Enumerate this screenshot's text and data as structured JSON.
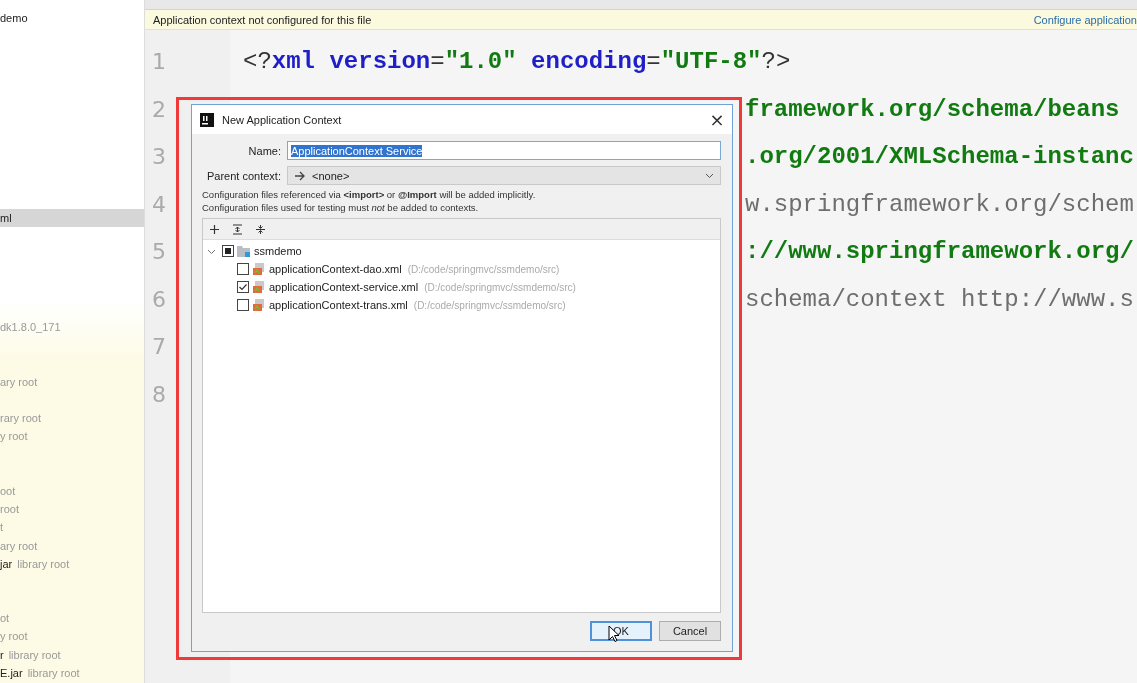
{
  "sidebar": {
    "items": [
      {
        "text": "demo",
        "selected": false
      },
      {
        "text": "ml",
        "selected": true
      },
      {
        "note": "dk1.8.0_171",
        "selected": false
      },
      {
        "note": "ary root",
        "selected": false
      },
      {
        "note": "rary root",
        "selected": false
      },
      {
        "note": "y root",
        "selected": false
      },
      {
        "note": "oot",
        "selected": false
      },
      {
        "note": "root",
        "selected": false
      },
      {
        "note": "t",
        "selected": false
      },
      {
        "note": "ary root",
        "selected": false
      },
      {
        "text": "jar",
        "note": "library root",
        "selected": false
      },
      {
        "note": "ot",
        "selected": false
      },
      {
        "note": "y root",
        "selected": false
      },
      {
        "text": "r",
        "note": "library root",
        "selected": false
      },
      {
        "text": "E.jar",
        "note": "library root",
        "selected": false
      }
    ]
  },
  "notification": {
    "message": "Application context not configured for this file",
    "link": "Configure application"
  },
  "editor": {
    "lines": [
      {
        "number": "1",
        "kind": "full",
        "segments": [
          {
            "text": "<?",
            "kind": "punct"
          },
          {
            "text": "xml",
            "kind": "tag"
          },
          {
            "text": " version",
            "kind": "tag"
          },
          {
            "text": "=",
            "kind": "punct"
          },
          {
            "text": "\"1.0\"",
            "kind": "value"
          },
          {
            "text": " encoding",
            "kind": "tag"
          },
          {
            "text": "=",
            "kind": "punct"
          },
          {
            "text": "\"UTF-8\"",
            "kind": "value"
          },
          {
            "text": "?>",
            "kind": "punct"
          }
        ]
      },
      {
        "number": "2",
        "kind": "tail",
        "segments": [
          {
            "text": "framework.org/schema/beans",
            "kind": "value"
          }
        ]
      },
      {
        "number": "3",
        "kind": "tail",
        "segments": [
          {
            "text": ".org/2001/XMLSchema-instanc",
            "kind": "value"
          }
        ]
      },
      {
        "number": "4",
        "kind": "tail",
        "segments": [
          {
            "text": "w.springframework.org/schem",
            "kind": "plain"
          }
        ]
      },
      {
        "number": "5",
        "kind": "tail",
        "segments": [
          {
            "text": "://www.springframework.org/",
            "kind": "value"
          }
        ]
      },
      {
        "number": "6",
        "kind": "tail",
        "segments": [
          {
            "text": "schema/context http://www.s",
            "kind": "plain"
          }
        ]
      },
      {
        "number": "7"
      },
      {
        "number": "8"
      }
    ]
  },
  "dialog": {
    "title": "New Application Context",
    "close": "×",
    "name_label": "Name:",
    "name_value": "ApplicationContext Service",
    "name_text_selected": true,
    "parent_label": "Parent context:",
    "parent_value": "<none>",
    "info": [
      "Configuration files referenced via **<import>** or **@Import** will be added implicitly.",
      "Configuration files used for testing must *not* be added to contexts."
    ],
    "tree": {
      "label": "ssmdemo",
      "expanded": true,
      "checked": false,
      "partial": true,
      "children": [
        {
          "label": "applicationContext-dao.xml",
          "path": "(D:/code/springmvc/ssmdemo/src)",
          "checked": false
        },
        {
          "label": "applicationContext-service.xml",
          "path": "(D:/code/springmvc/ssmdemo/src)",
          "checked": true
        },
        {
          "label": "applicationContext-trans.xml",
          "path": "(D:/code/springmvc/ssmdemo/src)",
          "checked": false
        }
      ]
    },
    "buttons": [
      {
        "label": "OK",
        "default": true
      },
      {
        "label": "Cancel",
        "default": false
      }
    ]
  }
}
